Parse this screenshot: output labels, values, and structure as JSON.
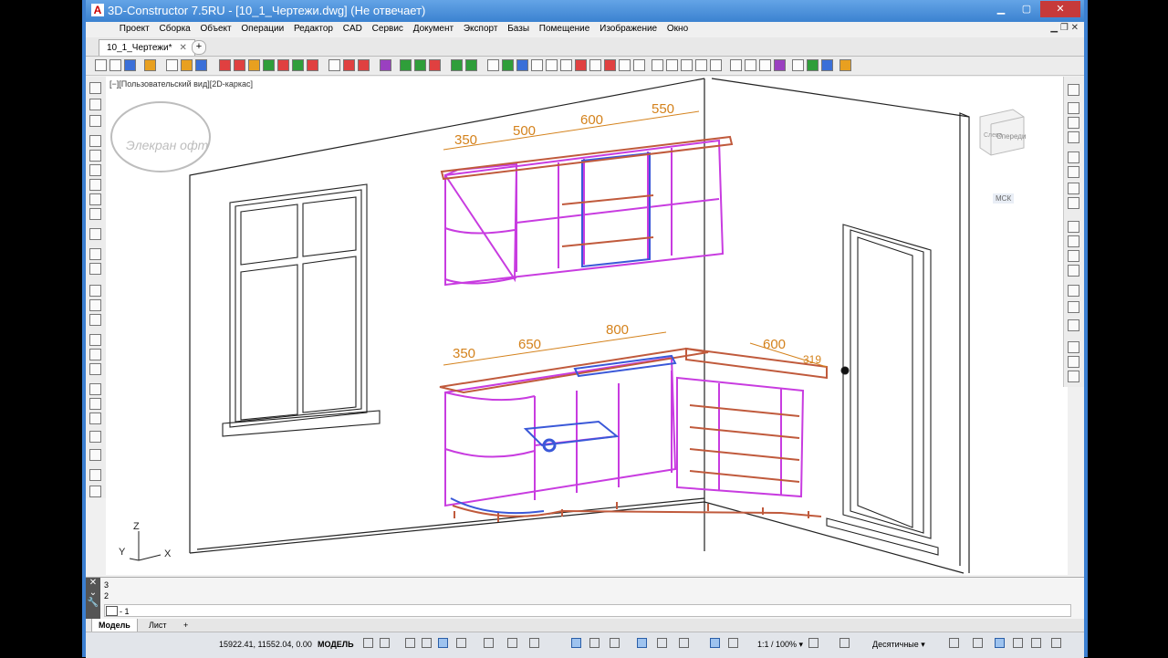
{
  "window": {
    "title": "3D-Constructor 7.5RU - [10_1_Чертежи.dwg] (Не отвечает)",
    "app_icon": "A"
  },
  "menu": [
    "Проект",
    "Сборка",
    "Объект",
    "Операции",
    "Редактор",
    "CAD",
    "Сервис",
    "Документ",
    "Экспорт",
    "Базы",
    "Помещение",
    "Изображение",
    "Окно"
  ],
  "doc_tab": {
    "label": "10_1_Чертежи*",
    "add": "+"
  },
  "viewport": {
    "label": "[−][Пользовательский вид][2D-каркас]",
    "viewcube_face1": "Слева",
    "viewcube_face2": "Спереди",
    "ucs_label": "МСК",
    "axes": {
      "z": "Z",
      "y": "Y",
      "x": "X"
    },
    "watermark": "Элекран офт"
  },
  "dimensions": {
    "upper": [
      "350",
      "500",
      "600",
      "550"
    ],
    "lower": [
      "350",
      "650",
      "800"
    ],
    "corner": [
      "600",
      "319"
    ]
  },
  "command": {
    "history": [
      "3",
      "2"
    ],
    "input": "- 1"
  },
  "layout_tabs": {
    "model": "Модель",
    "sheet": "Лист",
    "add": "+"
  },
  "status": {
    "coords": "15922.41, 11552.04, 0.00",
    "space": "МОДЕЛЬ",
    "scale": "1:1 / 100% ▾",
    "units": "Десятичные ▾"
  },
  "colors": {
    "titlebar": "#3b82d0",
    "dim": "#d4821c",
    "cabinet": "#c83ce0",
    "panel_wood": "#c05a3c",
    "accent_blue": "#3a58d8"
  }
}
